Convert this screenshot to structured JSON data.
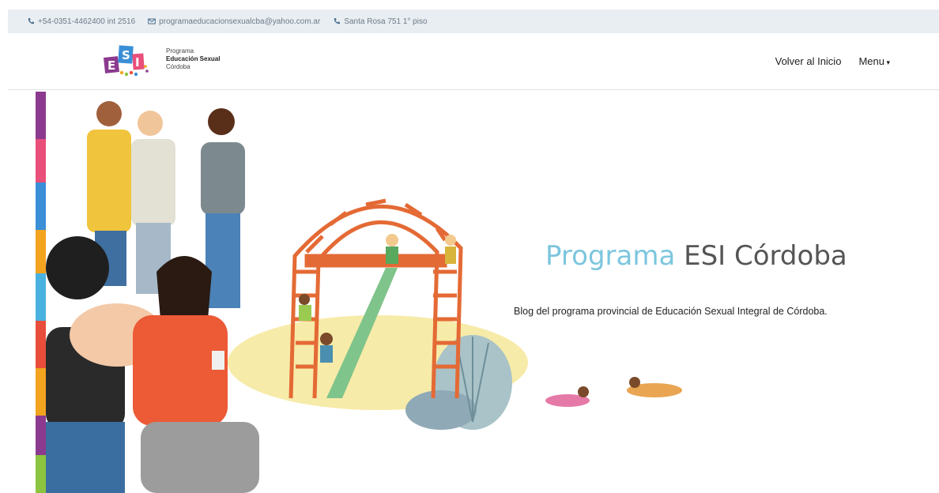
{
  "contact": {
    "phone": "+54-0351-4462400 int 2516",
    "email": "programaeducacionsexualcba@yahoo.com.ar",
    "address": "Santa Rosa 751 1° piso"
  },
  "brand": {
    "line1": "Programa",
    "line2": "Educación Sexual",
    "line3": "Córdoba",
    "logo_letters": [
      "E",
      "S",
      "I"
    ]
  },
  "nav": {
    "home": "Volver al Inicio",
    "menu": "Menu"
  },
  "hero": {
    "title_accent": "Programa",
    "title_rest": "ESI Córdoba",
    "subtitle": "Blog del programa provincial de Educación Sexual Integral de Córdoba."
  },
  "colors": {
    "accent": "#7cc6de",
    "topbar_bg": "#e9eef3",
    "stripe": [
      "#8b3a8f",
      "#e84f7a",
      "#3a8fd6",
      "#f2a41f",
      "#4ab2e0",
      "#e94d3b",
      "#8cc43f"
    ]
  }
}
